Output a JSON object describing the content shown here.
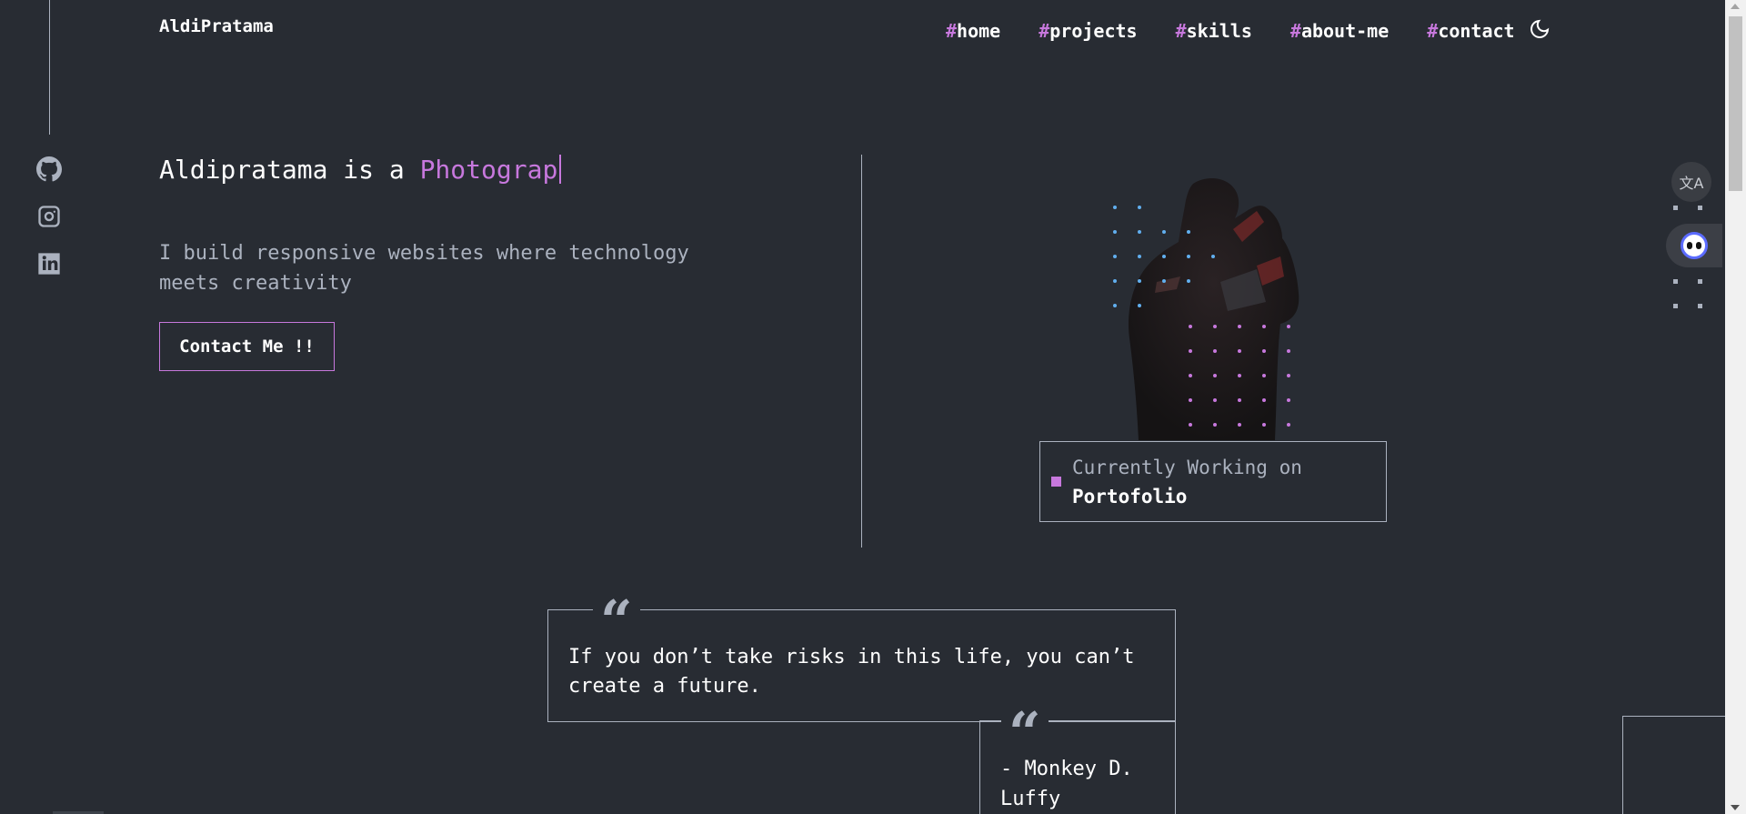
{
  "header": {
    "logo": "AldiPratama",
    "nav": [
      {
        "hash": "#",
        "label": "home"
      },
      {
        "hash": "#",
        "label": "projects"
      },
      {
        "hash": "#",
        "label": "skills"
      },
      {
        "hash": "#",
        "label": "about-me"
      },
      {
        "hash": "#",
        "label": "contact"
      }
    ],
    "theme_icon": "moon-icon"
  },
  "socials": [
    {
      "name": "github-icon"
    },
    {
      "name": "instagram-icon"
    },
    {
      "name": "linkedin-icon"
    }
  ],
  "hero": {
    "title_prefix": "Aldipratama is a ",
    "title_typed": "Photograp",
    "subtitle": "I build responsive websites where technology meets creativity",
    "cta_label": "Contact Me !!"
  },
  "status": {
    "label": "Currently Working on",
    "project": "Portofolio"
  },
  "quote": {
    "text": "If you don’t take risks in this life, you can’t create a future.",
    "author": "- Monkey D. Luffy",
    "mark": "“"
  },
  "widgets": {
    "translate_glyph": "文A",
    "assistant_icon": "assistant-icon"
  },
  "colors": {
    "background": "#282c33",
    "accent": "#c778dd",
    "muted": "#abb2bf",
    "dots_blue": "#61afef"
  }
}
